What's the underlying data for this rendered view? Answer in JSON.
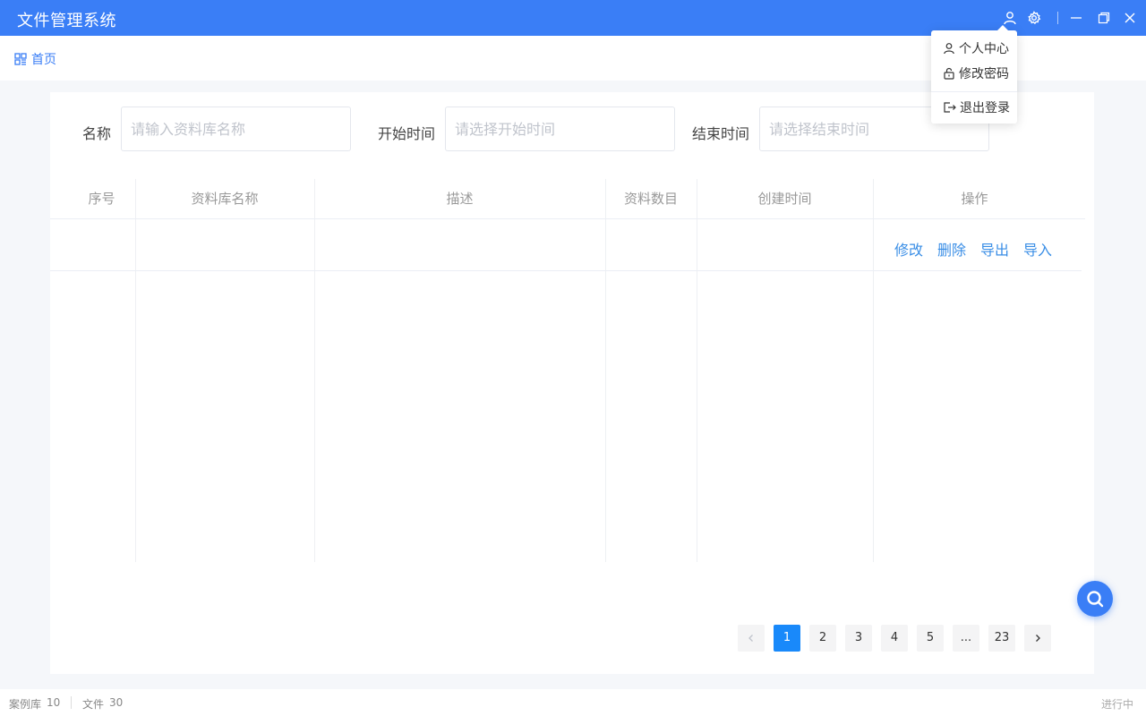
{
  "window": {
    "title": "文件管理系统",
    "accent_color": "#3a7ef6",
    "icons": [
      "user-icon",
      "gear-icon",
      "minimize-icon",
      "restore-icon",
      "close-icon"
    ]
  },
  "breadcrumb": {
    "icon": "grid-icon",
    "label": "首页"
  },
  "filters": {
    "name_label": "名称",
    "name_placeholder": "请输入资料库名称",
    "start_label": "开始时间",
    "start_placeholder": "请选择开始时间",
    "end_label": "结束时间",
    "end_placeholder": "请选择结束时间"
  },
  "table": {
    "columns": [
      "序号",
      "资料库名称",
      "描述",
      "资料数目",
      "创建时间",
      "操作"
    ],
    "rows": [
      {
        "index": "",
        "name": "",
        "description": "",
        "count": "",
        "created": "",
        "actions": [
          "修改",
          "删除",
          "导出",
          "导入"
        ]
      }
    ]
  },
  "pagination": {
    "prev": "‹",
    "pages": [
      "1",
      "2",
      "3",
      "4",
      "5",
      "...",
      "23"
    ],
    "current": "1",
    "next": "›"
  },
  "user_menu": {
    "items": [
      {
        "icon": "user-icon",
        "label": "个人中心"
      },
      {
        "icon": "lock-icon",
        "label": "修改密码"
      },
      {
        "icon": "logout-icon",
        "label": "退出登录"
      }
    ]
  },
  "statusbar": {
    "library_label": "案例库",
    "library_count": "10",
    "file_label": "文件",
    "file_count": "30",
    "right_text": "进行中"
  }
}
